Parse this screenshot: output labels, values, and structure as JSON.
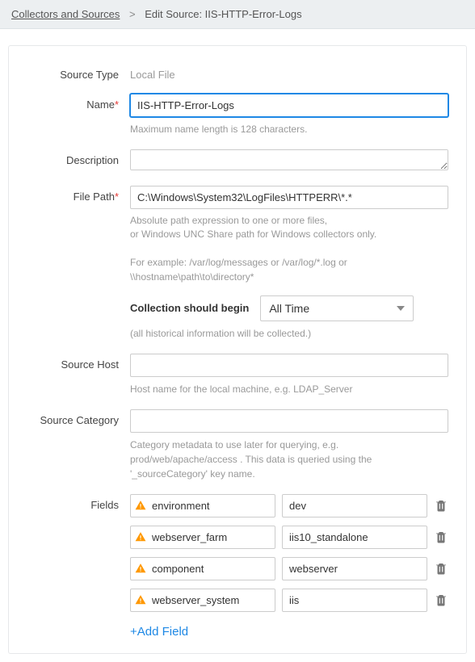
{
  "breadcrumb": {
    "root": "Collectors and Sources",
    "current": "Edit Source: IIS-HTTP-Error-Logs"
  },
  "form": {
    "sourceType": {
      "label": "Source Type",
      "value": "Local File"
    },
    "name": {
      "label": "Name",
      "value": "IIS-HTTP-Error-Logs",
      "hint": "Maximum name length is 128 characters."
    },
    "description": {
      "label": "Description",
      "value": ""
    },
    "filePath": {
      "label": "File Path",
      "value": "C:\\Windows\\System32\\LogFiles\\HTTPERR\\*.*",
      "hint1": "Absolute path expression to one or more files,",
      "hint2": "or Windows UNC Share path for Windows collectors only.",
      "hint3": "For example: /var/log/messages or /var/log/*.log or \\\\hostname\\path\\to\\directory*"
    },
    "collection": {
      "label": "Collection should begin",
      "value": "All Time",
      "hint": "(all historical information will be collected.)"
    },
    "sourceHost": {
      "label": "Source Host",
      "value": "",
      "hint": "Host name for the local machine, e.g. LDAP_Server"
    },
    "sourceCategory": {
      "label": "Source Category",
      "value": "",
      "hint": "Category metadata to use later for querying, e.g. prod/web/apache/access . This data is queried using the '_sourceCategory' key name."
    },
    "fields": {
      "label": "Fields",
      "addLabel": "+Add Field",
      "rows": [
        {
          "key": "environment",
          "value": "dev"
        },
        {
          "key": "webserver_farm",
          "value": "iis10_standalone"
        },
        {
          "key": "component",
          "value": "webserver"
        },
        {
          "key": "webserver_system",
          "value": "iis"
        }
      ]
    }
  }
}
